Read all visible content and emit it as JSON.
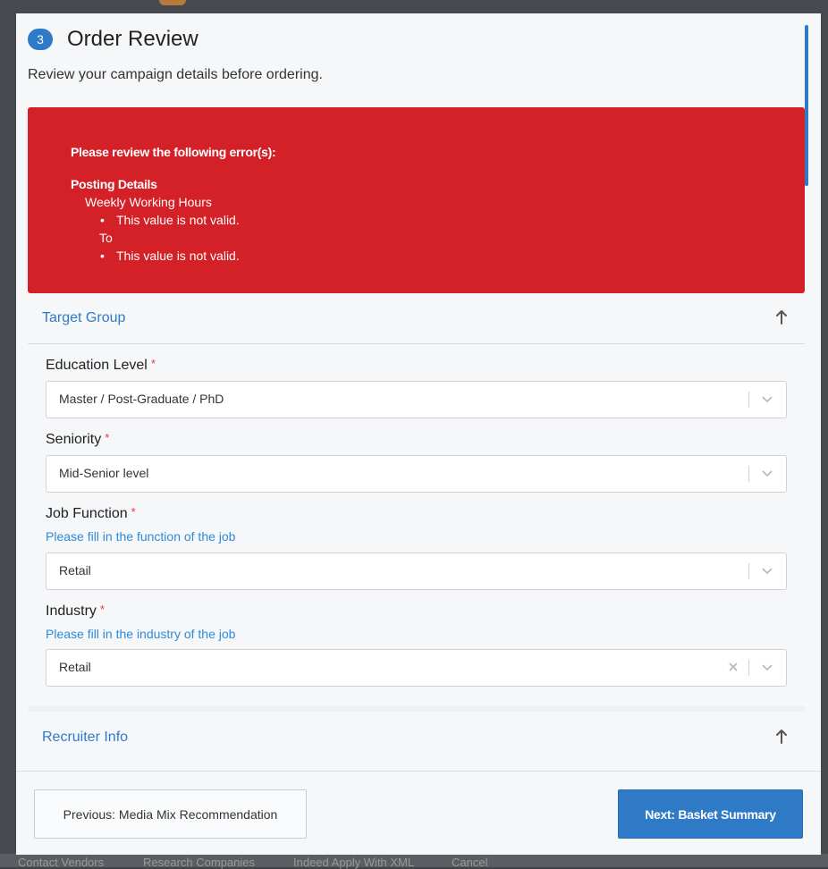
{
  "modal": {
    "step_number": "3",
    "title": "Order Review",
    "subtitle": "Review your campaign details before ordering."
  },
  "errors": {
    "heading": "Please review the following error(s):",
    "section": "Posting Details",
    "items": [
      {
        "field": "Weekly Working Hours",
        "message": "This value is not valid."
      },
      {
        "field": "To",
        "message": "This value is not valid."
      }
    ]
  },
  "target_group": {
    "title": "Target Group",
    "fields": [
      {
        "label": "Education Level",
        "required_mark": "*",
        "hint": "",
        "value": "Master / Post-Graduate / PhD"
      },
      {
        "label": "Seniority",
        "required_mark": "*",
        "hint": "",
        "value": "Mid-Senior level"
      },
      {
        "label": "Job Function",
        "required_mark": "*",
        "hint": "Please fill in the function of the job",
        "value": "Retail"
      },
      {
        "label": "Industry",
        "required_mark": "*",
        "hint": "Please fill in the industry of the job",
        "value": "Retail"
      }
    ]
  },
  "recruiter_info": {
    "title": "Recruiter Info"
  },
  "footer": {
    "prev_label": "Previous: Media Mix Recommendation",
    "next_label": "Next: Basket Summary"
  },
  "background": {
    "bottom_links": [
      "Contact Vendors",
      "Research Companies",
      "Indeed Apply With XML",
      "Cancel"
    ]
  },
  "colors": {
    "accent": "#2f7ac7",
    "error": "#d42027",
    "link": "#2f8ad8"
  }
}
